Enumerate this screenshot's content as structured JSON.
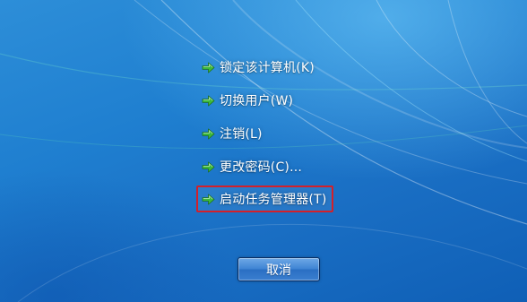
{
  "menu": {
    "items": [
      {
        "label": "锁定该计算机(K)",
        "icon": "green-arrow-icon"
      },
      {
        "label": "切换用户(W)",
        "icon": "green-arrow-icon"
      },
      {
        "label": "注销(L)",
        "icon": "green-arrow-icon"
      },
      {
        "label": "更改密码(C)...",
        "icon": "green-arrow-icon"
      },
      {
        "label": "启动任务管理器(T)",
        "icon": "green-arrow-icon",
        "highlighted": true
      }
    ]
  },
  "cancel_button": {
    "label": "取消"
  },
  "colors": {
    "background": "#1f7fd0",
    "highlight_border": "#d3202a",
    "arrow_green": "#3cb83a",
    "text": "#ffffff"
  }
}
